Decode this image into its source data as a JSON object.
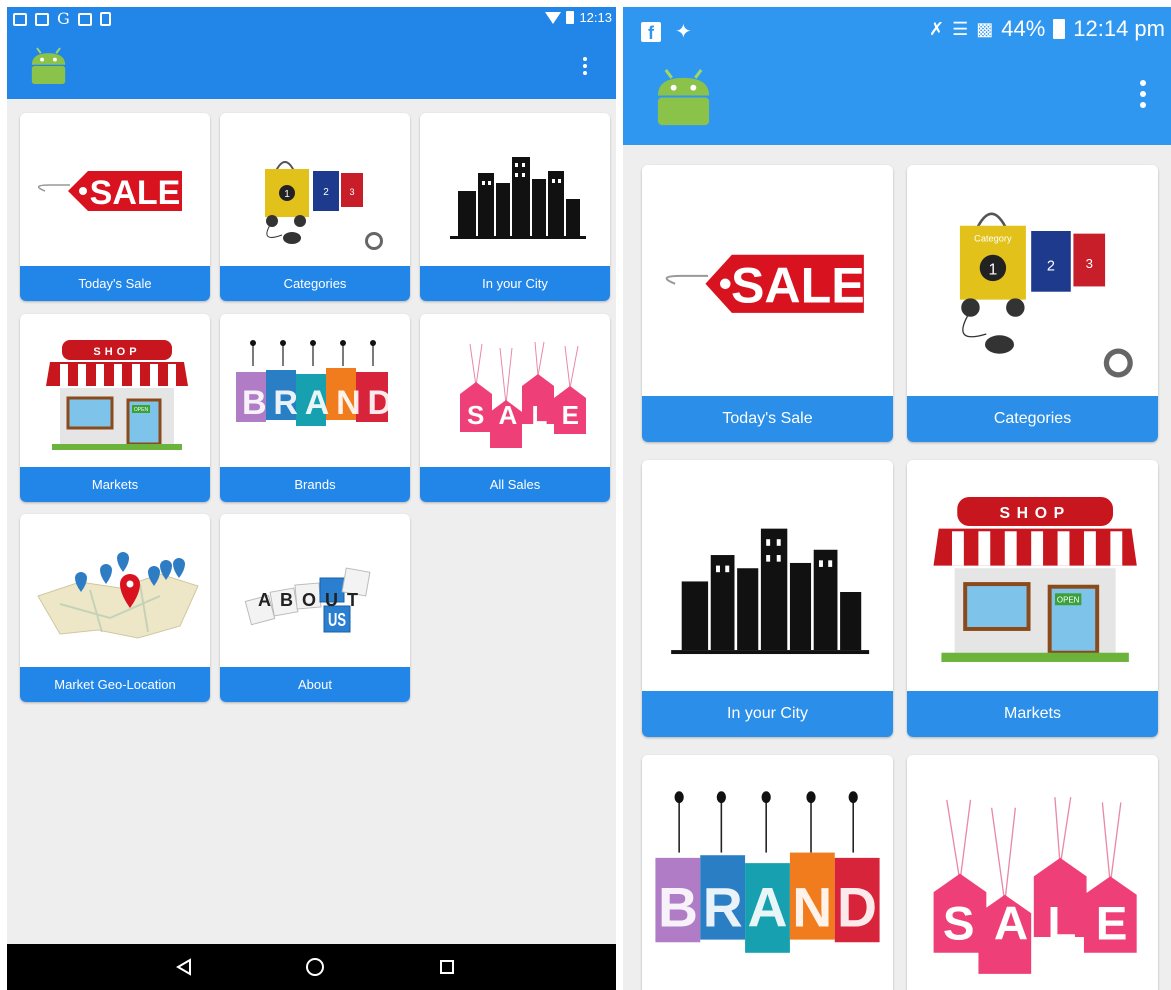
{
  "left": {
    "status_time": "12:13",
    "tiles": [
      {
        "label": "Today's Sale",
        "icon": "sale-tag-icon"
      },
      {
        "label": "Categories",
        "icon": "shopping-bags-icon"
      },
      {
        "label": "In your City",
        "icon": "city-skyline-icon"
      },
      {
        "label": "Markets",
        "icon": "shop-storefront-icon"
      },
      {
        "label": "Brands",
        "icon": "brand-tags-icon"
      },
      {
        "label": "All Sales",
        "icon": "sale-hanging-tags-icon"
      },
      {
        "label": "Market Geo-Location",
        "icon": "map-pins-icon"
      },
      {
        "label": "About",
        "icon": "about-us-blocks-icon"
      }
    ]
  },
  "right": {
    "status_battery": "44%",
    "status_time": "12:14 pm",
    "tiles": [
      {
        "label": "Today's Sale"
      },
      {
        "label": "Categories"
      },
      {
        "label": "In your City"
      },
      {
        "label": "Markets"
      },
      {
        "label": "",
        "icon": "brand-tags-icon"
      },
      {
        "label": "",
        "icon": "sale-hanging-tags-icon"
      }
    ]
  },
  "art": {
    "sale_word": "SALE",
    "shop_word": "SHOP",
    "open_word": "OPEN",
    "brand_word": "BRAND",
    "category_word": "Category",
    "about_word": "ABOUT",
    "us_word": "US",
    "bag_numbers": [
      "1",
      "2",
      "3"
    ]
  },
  "colors": {
    "primary": "#2186e8",
    "sale_red": "#d8121f",
    "sale_pink": "#f0407a"
  }
}
